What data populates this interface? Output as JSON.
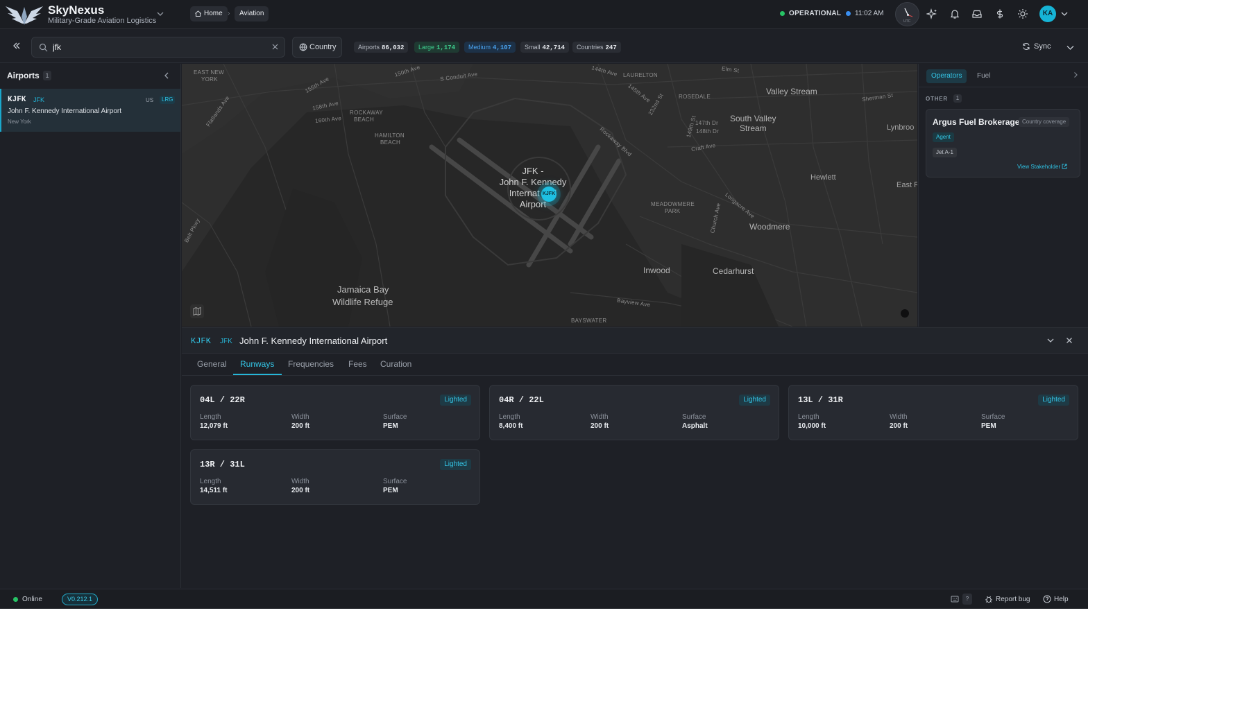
{
  "brand": {
    "name": "SkyNexus",
    "subtitle": "Military-Grade Aviation Logistics"
  },
  "breadcrumb": {
    "home": "Home",
    "current": "Aviation"
  },
  "status": {
    "label": "OPERATIONAL",
    "time": "11:02 AM",
    "operational_color": "#27c365",
    "time_dot_color": "#3a8ef0"
  },
  "clock": {
    "label": "UTC"
  },
  "user": {
    "initials": "KA"
  },
  "search": {
    "value": "jfk",
    "placeholder": "Search airports..."
  },
  "filter": {
    "country_label": "Country",
    "stats": [
      {
        "label": "Airports",
        "value": "86,032",
        "color": "#b7bcc5"
      },
      {
        "label": "Large",
        "value": "1,174",
        "color": "#3ecf8e"
      },
      {
        "label": "Medium",
        "value": "4,107",
        "color": "#4aa3f0"
      },
      {
        "label": "Small",
        "value": "42,714",
        "color": "#b7bcc5"
      },
      {
        "label": "Countries",
        "value": "247",
        "color": "#b7bcc5"
      }
    ],
    "sync_label": "Sync"
  },
  "sidebar": {
    "title": "Airports",
    "count": "1",
    "items": [
      {
        "icao": "KJFK",
        "iata": "JFK",
        "country": "US",
        "size": "LRG",
        "name": "John F. Kennedy International Airport",
        "city": "New York"
      }
    ]
  },
  "map": {
    "airport_label_line1": "JFK -",
    "airport_label_line2": "John F. Kennedy",
    "airport_label_line3": "Internat",
    "airport_label_line3b": "l",
    "airport_label_line4": "Airport",
    "marker_label": "KJFK",
    "labels": {
      "east_new_york": "EAST NEW",
      "york": "YORK",
      "rockaway_beach": "ROCKAWAY",
      "beach": "BEACH",
      "hamilton": "HAMILTON",
      "hamilton_beach": "BEACH",
      "laurelton": "LAURELTON",
      "rosedale": "ROSEDALE",
      "valley_stream": "Valley Stream",
      "south_valley_stream": "South Valley",
      "stream": "Stream",
      "lynbrook": "Lynbroo",
      "hewlett": "Hewlett",
      "east_r": "East R",
      "meadowmere_park": "MEADOWMERE",
      "park": "PARK",
      "woodmere": "Woodmere",
      "inwood": "Inwood",
      "cedarhurst": "Cedarhurst",
      "jamaica_bay": "Jamaica Bay",
      "wildlife_refuge": "Wildlife Refuge",
      "bayswater": "BAYSWATER",
      "bayview_ave": "Bayview Ave",
      "rockaway_blvd": "Rockaway Blvd",
      "conduit_ave": "S Conduit Ave",
      "belt_pkwy": "Belt Pkwy",
      "flatlands_ave": "Flatlands Ave",
      "ave_150th": "150th Ave",
      "ave_155th": "155th Ave",
      "ave_158th": "158th Ave",
      "ave_160th": "160th Ave",
      "ave_144th": "144th Ave",
      "ave_145th": "145th Ave",
      "ave_147th": "147th Dr",
      "ave_148th": "148th Dr",
      "st_149th": "149th St",
      "st_232nd": "232nd St",
      "elm_st": "Elm St",
      "craft_ave": "Craft Ave",
      "sherman_st": "Sherman St",
      "church_ave": "Church Ave",
      "longacre_ave": "Longacre Ave"
    }
  },
  "right_panel": {
    "tabs": [
      "Operators",
      "Fuel"
    ],
    "section": "OTHER",
    "section_count": "1",
    "operator": {
      "name": "Argus Fuel Brokerage",
      "coverage": "Country coverage",
      "role": "Agent",
      "fuel": "Jet A-1",
      "link": "View Stakeholder"
    }
  },
  "detail": {
    "icao": "KJFK",
    "iata": "JFK",
    "name": "John F. Kennedy International Airport",
    "tabs": [
      "General",
      "Runways",
      "Frequencies",
      "Fees",
      "Curation"
    ],
    "active_tab": "Runways",
    "field_labels": {
      "length": "Length",
      "width": "Width",
      "surface": "Surface"
    },
    "runways": [
      {
        "id": "04L / 22R",
        "lighting": "Lighted",
        "length": "12,079 ft",
        "width": "200 ft",
        "surface": "PEM"
      },
      {
        "id": "04R / 22L",
        "lighting": "Lighted",
        "length": "8,400 ft",
        "width": "200 ft",
        "surface": "Asphalt"
      },
      {
        "id": "13L / 31R",
        "lighting": "Lighted",
        "length": "10,000 ft",
        "width": "200 ft",
        "surface": "PEM"
      },
      {
        "id": "13R / 31L",
        "lighting": "Lighted",
        "length": "14,511 ft",
        "width": "200 ft",
        "surface": "PEM"
      }
    ]
  },
  "statusbar": {
    "connection": "Online",
    "version": "V0.212.1",
    "shortcut_key": "?",
    "report_bug": "Report bug",
    "help": "Help"
  },
  "colors": {
    "accent": "#26b6d8",
    "background": "#1e2026",
    "online": "#27c365"
  }
}
